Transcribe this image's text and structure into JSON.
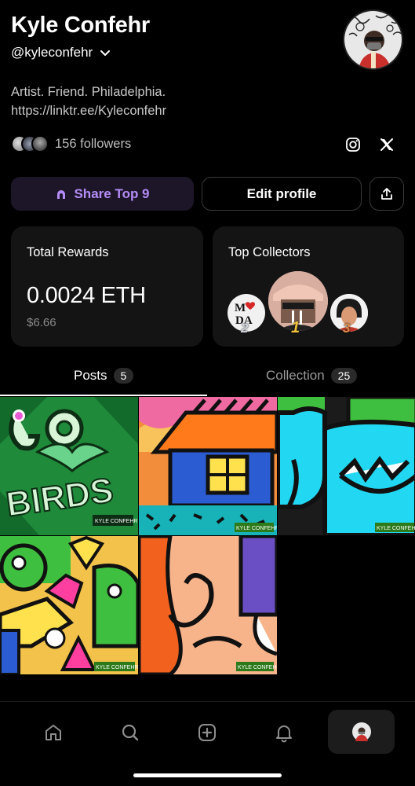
{
  "profile": {
    "name": "Kyle Confehr",
    "handle": "@kyleconfehr",
    "bio_line1": "Artist. Friend. Philadelphia.",
    "bio_line2": "https://linktr.ee/Kyleconfehr",
    "followers": "156 followers"
  },
  "actions": {
    "share_label": "Share Top 9",
    "edit_label": "Edit profile"
  },
  "rewards": {
    "title": "Total Rewards",
    "eth": "0.0024 ETH",
    "usd": "$6.66"
  },
  "collectors": {
    "title": "Top Collectors",
    "ranks": [
      "2",
      "1",
      "3"
    ],
    "badge_text": "MDA"
  },
  "tabs": [
    {
      "label": "Posts",
      "count": "5",
      "active": true
    },
    {
      "label": "Collection",
      "count": "25",
      "active": false
    }
  ],
  "posts": [
    {
      "title": "GO BIRDS",
      "signature": "KYLE CONFEHR"
    },
    {
      "title": "",
      "signature": "KYLE CONFEHR"
    },
    {
      "title": "",
      "signature": "KYLE CONFEHR"
    },
    {
      "title": "",
      "signature": "KYLE CONFEHR"
    },
    {
      "title": "",
      "signature": "KYLE CONFEHR"
    }
  ],
  "nav": {
    "items": [
      "home-icon",
      "search-icon",
      "add-icon",
      "bell-icon",
      "profile-avatar"
    ],
    "active": "profile-avatar"
  },
  "colors": {
    "accent": "#b48cf7",
    "background": "#000000",
    "card": "#141414"
  }
}
